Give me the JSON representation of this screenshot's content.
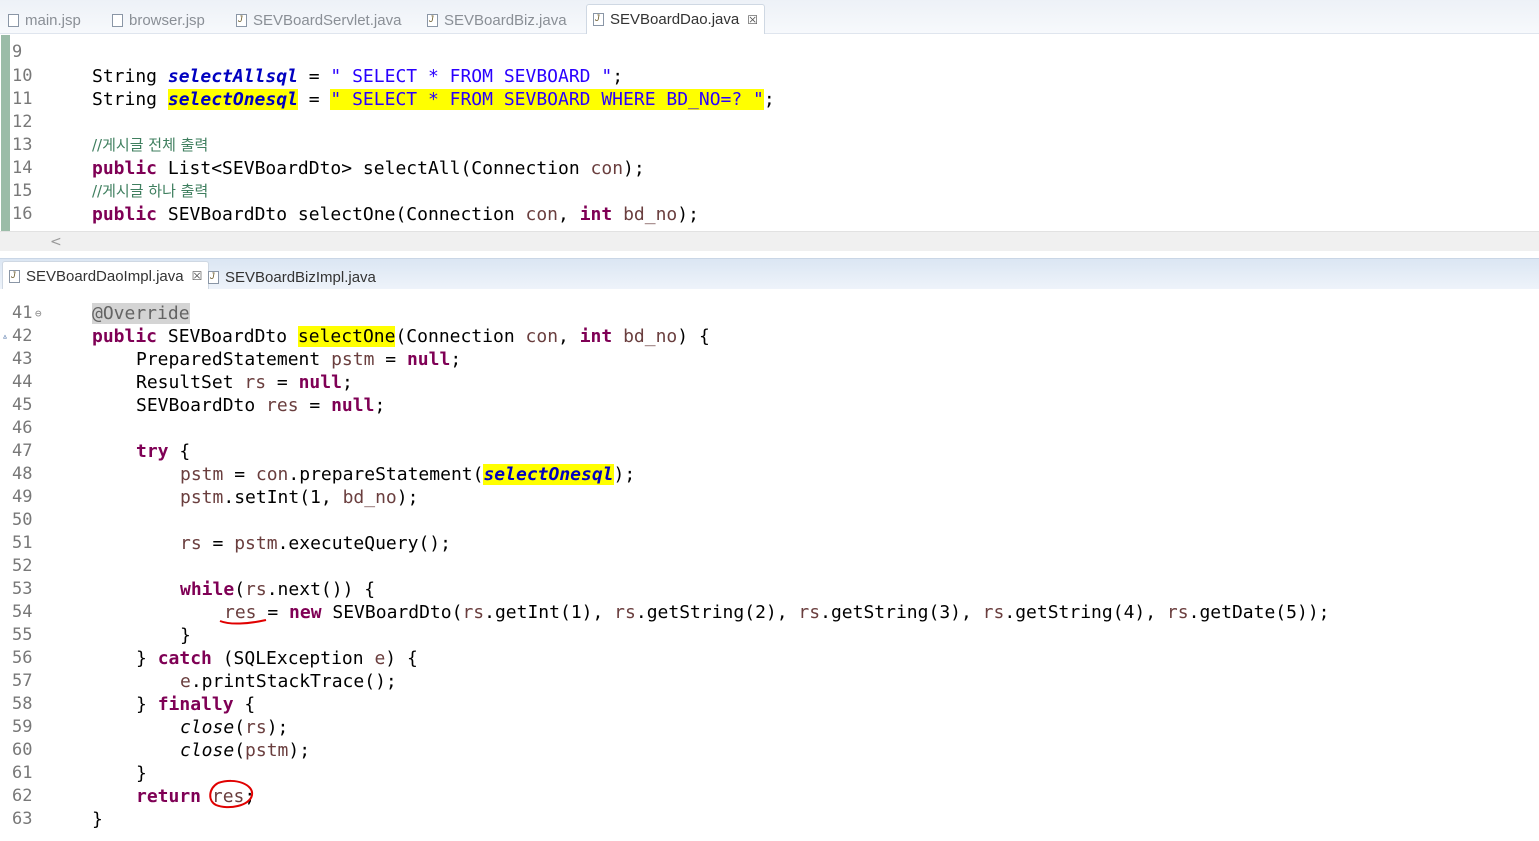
{
  "top_tabs": [
    {
      "label": "main.jsp",
      "icon": "jsp-file-icon"
    },
    {
      "label": "browser.jsp",
      "icon": "jsp-file-icon"
    },
    {
      "label": "SEVBoardServlet.java",
      "icon": "java-file-icon"
    },
    {
      "label": "SEVBoardBiz.java",
      "icon": "java-file-icon"
    },
    {
      "label": "SEVBoardDao.java",
      "icon": "java-file-icon",
      "close": "☒"
    }
  ],
  "bottom_tabs": [
    {
      "label": "SEVBoardDaoImpl.java",
      "icon": "java-file-icon",
      "close": "☒"
    },
    {
      "label": "SEVBoardBizImpl.java",
      "icon": "java-file-icon"
    }
  ],
  "top_editor": {
    "line_numbers": [
      "9",
      "10",
      "11",
      "12",
      "13",
      "14",
      "15",
      "16"
    ],
    "lines": {
      "l10": {
        "type": "String ",
        "name": "selectAllsql",
        "eq": " = ",
        "str": "\" SELECT * FROM SEVBOARD \"",
        "end": ";"
      },
      "l11": {
        "type": "String ",
        "name": "selectOnesql",
        "eq": " = ",
        "str": "\" SELECT * FROM SEVBOARD WHERE BD_NO=? \"",
        "end": ";"
      },
      "l13": "//게시글 전체 출력",
      "l14": {
        "kw": "public",
        "rest": " List<SEVBoardDto> selectAll(Connection ",
        "p": "con",
        "end": ");"
      },
      "l15": "//게시글 하나 출력",
      "l16": {
        "kw": "public",
        "rest": " SEVBoardDto selectOne(Connection ",
        "p": "con",
        "mid": ", ",
        "kw2": "int",
        "sp": " ",
        "p2": "bd_no",
        "end": ");"
      }
    },
    "scroll_left": "<"
  },
  "bottom_editor": {
    "line_numbers": [
      "41",
      "42",
      "43",
      "44",
      "45",
      "46",
      "47",
      "48",
      "49",
      "50",
      "51",
      "52",
      "53",
      "54",
      "55",
      "56",
      "57",
      "58",
      "59",
      "60",
      "61",
      "62",
      "63"
    ],
    "fold_marker": "⊖",
    "override_marker": "▵",
    "annotation": "@Override",
    "l42": {
      "kw": "public",
      "a": " SEVBoardDto ",
      "m": "selectOne",
      "b": "(Connection ",
      "p": "con",
      "c": ", ",
      "kw2": "int",
      "d": " ",
      "p2": "bd_no",
      "e": ") {"
    },
    "l43": {
      "a": "PreparedStatement ",
      "v": "pstm",
      "b": " = ",
      "kw": "null",
      "c": ";"
    },
    "l44": {
      "a": "ResultSet ",
      "v": "rs",
      "b": " = ",
      "kw": "null",
      "c": ";"
    },
    "l45": {
      "a": "SEVBoardDto ",
      "v": "res",
      "b": " = ",
      "kw": "null",
      "c": ";"
    },
    "l47": {
      "kw": "try",
      "a": " {"
    },
    "l48": {
      "v": "pstm",
      "a": " = ",
      "p": "con",
      "b": ".prepareStatement(",
      "f": "selectOnesql",
      "c": ");"
    },
    "l49": {
      "v": "pstm",
      "a": ".setInt(1, ",
      "p": "bd_no",
      "b": ");"
    },
    "l51": {
      "v": "rs",
      "a": " = ",
      "v2": "pstm",
      "b": ".executeQuery();"
    },
    "l53": {
      "kw": "while",
      "a": "(",
      "v": "rs",
      "b": ".next()) {"
    },
    "l54": {
      "v": "res",
      "a": " = ",
      "kw": "new",
      "b": " SEVBoardDto(",
      "r1": "rs",
      "c": ".getInt(1), ",
      "r2": "rs",
      "d": ".getString(2), ",
      "r3": "rs",
      "e": ".getString(3), ",
      "r4": "rs",
      "f": ".getString(4), ",
      "r5": "rs",
      "g": ".getDate(5));"
    },
    "l55": "}",
    "l56": {
      "a": "} ",
      "kw": "catch",
      "b": " (SQLException ",
      "p": "e",
      "c": ") {"
    },
    "l57": {
      "p": "e",
      "a": ".printStackTrace();"
    },
    "l58": {
      "a": "} ",
      "kw": "finally",
      "b": " {"
    },
    "l59": {
      "m": "close",
      "a": "(",
      "v": "rs",
      "b": ");"
    },
    "l60": {
      "m": "close",
      "a": "(",
      "v": "pstm",
      "b": ");"
    },
    "l61": "}",
    "l62": {
      "kw": "return",
      "a": " ",
      "v": "res",
      "b": ";"
    },
    "l63": "}"
  },
  "colors": {
    "keyword": "#7f0055",
    "string": "#2a00ff",
    "field": "#0000c0",
    "local": "#6a3e3e",
    "comment": "#3f7f5f",
    "highlight": "#ffff00",
    "markup": "#e00000"
  }
}
